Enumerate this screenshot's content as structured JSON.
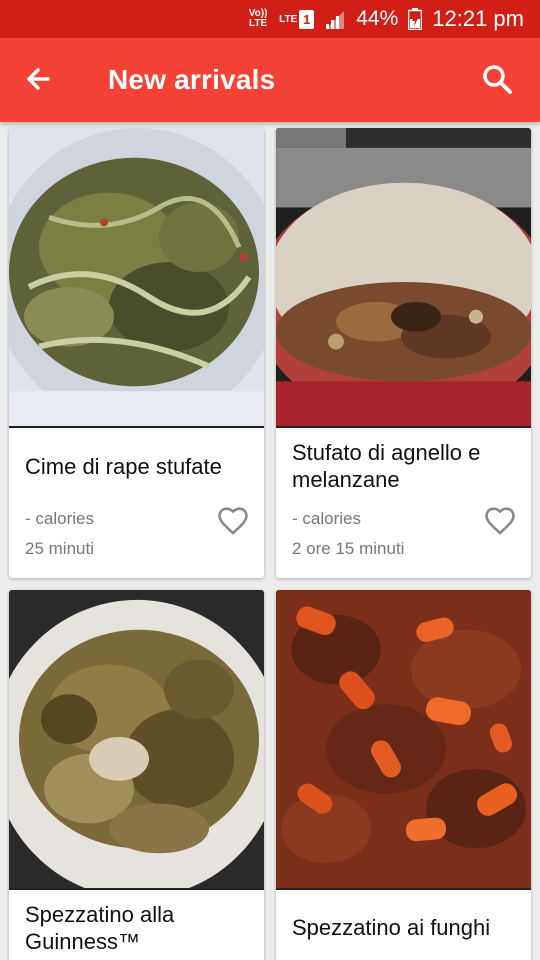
{
  "status_bar": {
    "volte_label": "Vo)) LTE",
    "network": "LTE",
    "sim": "1",
    "battery": "44%",
    "time": "12:21 pm"
  },
  "app_bar": {
    "title": "New arrivals",
    "back_icon": "arrow-back-icon",
    "search_icon": "search-icon",
    "color": "#f44336"
  },
  "recipes": [
    {
      "title": "Cime di rape stufate",
      "calories": "- calories",
      "time": "25 minuti",
      "image": "braised turnip greens in bowl"
    },
    {
      "title": "Stufato di agnello e melanzane",
      "calories": "- calories",
      "time": "2 ore 15 minuti",
      "image": "lamb and eggplant stew in red pot"
    },
    {
      "title": "Spezzatino alla Guinness™",
      "calories": "",
      "time": "",
      "image": "guinness beef stew on plate"
    },
    {
      "title": "Spezzatino ai funghi",
      "calories": "",
      "time": "",
      "image": "beef stew with carrots"
    }
  ]
}
